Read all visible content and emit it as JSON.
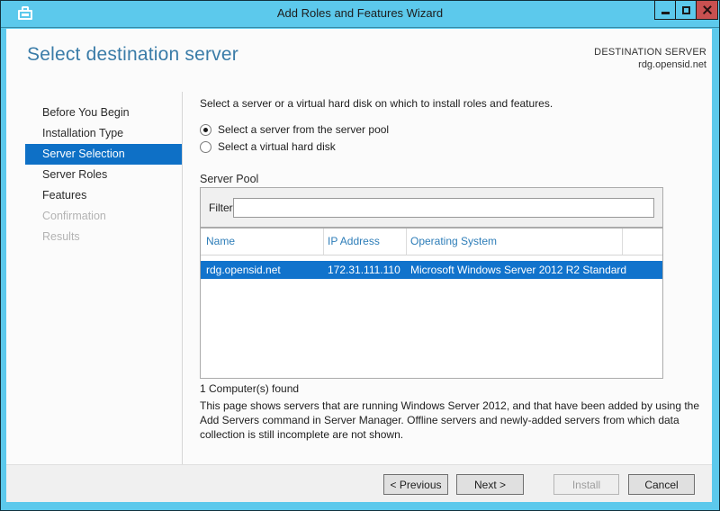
{
  "window": {
    "title": "Add Roles and Features Wizard",
    "controls": [
      {
        "name": "minimize"
      },
      {
        "name": "maximize"
      },
      {
        "name": "close"
      }
    ]
  },
  "header": {
    "title": "Select destination server",
    "destination_label": "DESTINATION SERVER",
    "destination_value": "rdg.opensid.net"
  },
  "sidebar": {
    "items": [
      {
        "label": "Before You Begin",
        "state": "enabled"
      },
      {
        "label": "Installation Type",
        "state": "enabled"
      },
      {
        "label": "Server Selection",
        "state": "selected"
      },
      {
        "label": "Server Roles",
        "state": "enabled"
      },
      {
        "label": "Features",
        "state": "enabled"
      },
      {
        "label": "Confirmation",
        "state": "disabled"
      },
      {
        "label": "Results",
        "state": "disabled"
      }
    ]
  },
  "main": {
    "intro": "Select a server or a virtual hard disk on which to install roles and features.",
    "radio_options": [
      {
        "label": "Select a server from the server pool",
        "selected": true
      },
      {
        "label": "Select a virtual hard disk",
        "selected": false
      }
    ],
    "server_pool": {
      "title": "Server Pool",
      "filter_label": "Filter:",
      "filter_value": "",
      "columns": [
        "Name",
        "IP Address",
        "Operating System"
      ],
      "rows": [
        {
          "name": "rdg.opensid.net",
          "ip": "172.31.111.110",
          "os": "Microsoft Windows Server 2012 R2 Standard",
          "selected": true
        }
      ],
      "count_text": "1 Computer(s) found"
    },
    "description": "This page shows servers that are running Windows Server 2012, and that have been added by using the Add Servers command in Server Manager. Offline servers and newly-added servers from which data collection is still incomplete are not shown."
  },
  "footer": {
    "buttons": [
      {
        "label": "< Previous",
        "enabled": true
      },
      {
        "label": "Next >",
        "enabled": true
      },
      {
        "label": "Install",
        "enabled": false
      },
      {
        "label": "Cancel",
        "enabled": true
      }
    ]
  },
  "colors": {
    "titlebar_bg": "#5cc9ec",
    "selection_blue": "#1173cc",
    "nav_selected_blue": "#0e70c6",
    "heading_blue": "#3a7ca8",
    "column_header_blue": "#2d7db8",
    "close_button_bg": "#c75050"
  }
}
